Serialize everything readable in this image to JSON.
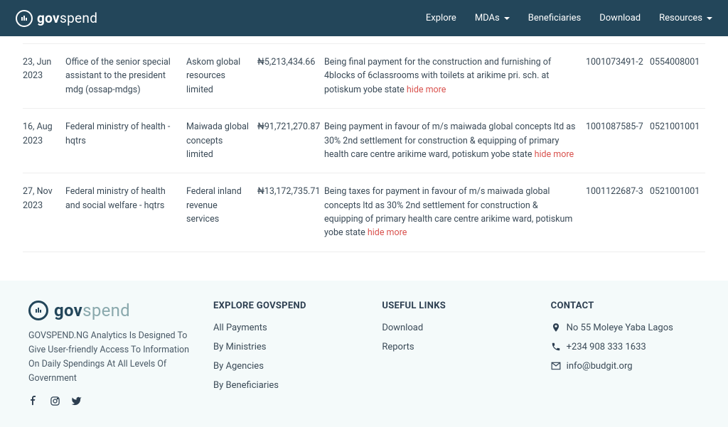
{
  "brand": {
    "pre": "gov",
    "post": "spend"
  },
  "nav": {
    "explore": "Explore",
    "mdas": "MDAs",
    "beneficiaries": "Beneficiaries",
    "download": "Download",
    "resources": "Resources"
  },
  "rows": [
    {
      "date": "23, Jun 2023",
      "ministry": "Office of the senior special assistant to the president mdg (ossap-mdgs)",
      "beneficiary": "Askom global resources limited",
      "amount": "₦5,213,434.66",
      "description": "Being final payment for the construction and furnishing of 4blocks of 6classrooms with toilets at arikime pri. sch. at potiskum yobe state ",
      "ref1": "1001073491-2",
      "ref2": "0554008001"
    },
    {
      "date": "16, Aug 2023",
      "ministry": "Federal ministry of health - hqtrs",
      "beneficiary": "Maiwada global concepts limited",
      "amount": "₦91,721,270.87",
      "description": "Being payment in favour of m/s maiwada global concepts ltd as 30% 2nd settlement for construction & equipping of primary health care centre arikime ward, potiskum yobe state ",
      "ref1": "1001087585-7",
      "ref2": "0521001001"
    },
    {
      "date": "27, Nov 2023",
      "ministry": "Federal ministry of health and social welfare - hqtrs",
      "beneficiary": "Federal inland revenue services",
      "amount": "₦13,172,735.71",
      "description": "Being taxes for payment in favour of m/s maiwada global concepts ltd as 30% 2nd settlement for construction & equipping of primary health care centre arikime ward, potiskum yobe state ",
      "ref1": "1001122687-3",
      "ref2": "0521001001"
    }
  ],
  "hideMore": "hide more",
  "footer": {
    "desc": "GOVSPEND.NG Analytics Is Designed To Give User-friendly Access To Information On Daily Spendings At All Levels Of Government",
    "explore": {
      "title": "EXPLORE GOVSPEND",
      "links": [
        "All Payments",
        "By Ministries",
        "By Agencies",
        "By Beneficiaries"
      ]
    },
    "useful": {
      "title": "USEFUL LINKS",
      "links": [
        "Download",
        "Reports"
      ]
    },
    "contact": {
      "title": "CONTACT",
      "address": "No 55 Moleye Yaba Lagos",
      "phone": "+234 908 333 1633",
      "email": "info@budgit.org"
    }
  }
}
